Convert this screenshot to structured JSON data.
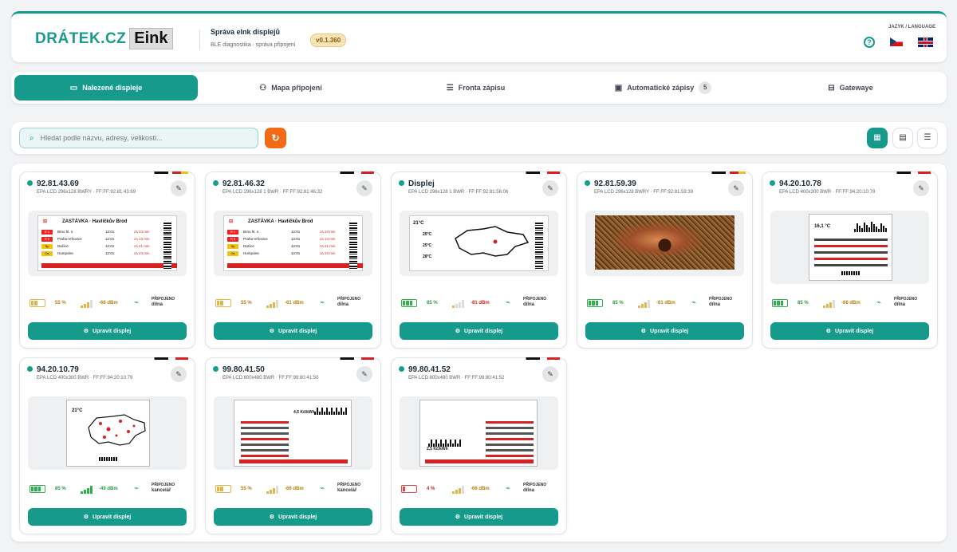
{
  "header": {
    "logo_text": "DRÁTEK.CZ",
    "logo_badge": "Eink",
    "title": "Správa eInk displejů",
    "subtitle": "BLE diagnostika · správa připojení",
    "version": "v0.1.360",
    "lang_label": "JAZYK / LANGUAGE",
    "help": "?"
  },
  "tabs": [
    {
      "label": "Nalezené displeje",
      "icon": "display-icon",
      "active": true
    },
    {
      "label": "Mapa připojení",
      "icon": "network-icon"
    },
    {
      "label": "Fronta zápisu",
      "icon": "queue-icon"
    },
    {
      "label": "Automatické zápisy",
      "icon": "calendar-icon",
      "count": "5"
    },
    {
      "label": "Gatewaye",
      "icon": "router-icon"
    }
  ],
  "search": {
    "placeholder": "Hledat podle názvu, adresy, velikosti..."
  },
  "button_label": "Upravit displej",
  "connected_label": "PŘIPOJENO",
  "cards": [
    {
      "ip": "92.81.43.69",
      "sub": "EPA LCD 296x128 BWRY · FF:FF:92:81:43:69",
      "battery": "55 %",
      "batt_level": 0.55,
      "rssi": "-66 dBm",
      "location": "dílna"
    },
    {
      "ip": "92.81.46.32",
      "sub": "EPA LCD 296x128 1 BWR · FF:FF:92:81:46:32",
      "battery": "55 %",
      "batt_level": 0.55,
      "rssi": "-61 dBm",
      "location": "dílna"
    },
    {
      "ip": "Displej",
      "sub": "EPA LCD 296x128 1 BWR · FF:FF:92:81:56:06",
      "battery": "85 %",
      "batt_level": 0.85,
      "rssi": "-81 dBm",
      "location": "dílna"
    },
    {
      "ip": "92.81.59.39",
      "sub": "EPA LCD 296x128 BWRY · FF:FF:92:81:59:39",
      "battery": "85 %",
      "batt_level": 0.85,
      "rssi": "-61 dBm",
      "location": "dílna"
    },
    {
      "ip": "94.20.10.78",
      "sub": "EPA LCD 400x300 BWR · FF:FF:94:20:10:78",
      "battery": "85 %",
      "batt_level": 0.85,
      "rssi": "-68 dBm",
      "location": "dílna"
    },
    {
      "ip": "94.20.10.79",
      "sub": "EPA LCD 400x300 BWR · FF:FF:94:20:10:79",
      "battery": "85 %",
      "batt_level": 0.85,
      "rssi": "-49 dBm",
      "location": "kancelář"
    },
    {
      "ip": "99.80.41.50",
      "sub": "EPA LCD 800x480 BWR · FF:FF:99:80:41:50",
      "battery": "55 %",
      "batt_level": 0.55,
      "rssi": "-66 dBm",
      "location": "kancelář"
    },
    {
      "ip": "99.80.41.52",
      "sub": "EPA LCD 800x480 BWR · FF:FF:99:80:41:52",
      "battery": "4 %",
      "batt_level": 0.04,
      "rssi": "-66 dBm",
      "location": "dílna"
    }
  ],
  "preview": {
    "stop_title": "ZASTÁVKA · Havlíčkův Brod",
    "rows": [
      {
        "tag": "R 1",
        "dest": "Brno hl. n.",
        "time": "12:01",
        "eta": "za 23 min"
      },
      {
        "tag": "R 5",
        "dest": "Praha-Vršovice",
        "time": "12:01",
        "eta": "za 13 min"
      },
      {
        "tag": "Sp",
        "dest": "Dačice",
        "time": "12:01",
        "eta": "za 21 min"
      },
      {
        "tag": "Os",
        "dest": "Humpolec",
        "time": "12:01",
        "eta": "za 23 min"
      }
    ],
    "weather": [
      "21°C",
      "25°C",
      "25°C",
      "28°C"
    ],
    "temp": "16,1 °C",
    "price": "2,5 Kč/kWh",
    "price2": "4,5 Kč/kWh"
  }
}
